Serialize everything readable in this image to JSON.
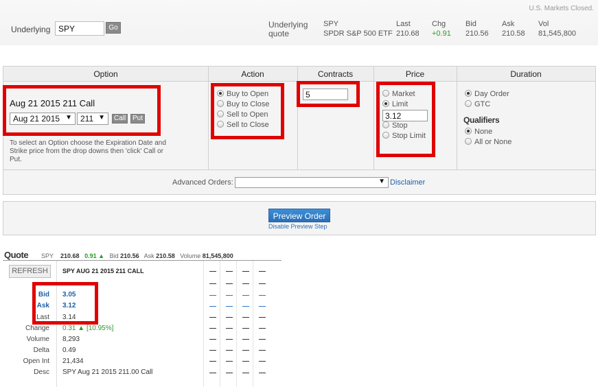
{
  "header": {
    "market_status": "U.S. Markets Closed.",
    "underlying_label": "Underlying",
    "underlying_value": "SPY",
    "go_label": "Go",
    "underlying_quote_label": "Underlying quote",
    "symbol": "SPY",
    "symbol_name": "SPDR S&P 500 ETF",
    "columns": [
      {
        "label": "Last",
        "value": "210.68"
      },
      {
        "label": "Chg",
        "value": "+0.91"
      },
      {
        "label": "Bid",
        "value": "210.56"
      },
      {
        "label": "Ask",
        "value": "210.58"
      },
      {
        "label": "Vol",
        "value": "81,545,800"
      }
    ]
  },
  "order": {
    "headers": {
      "option": "Option",
      "action": "Action",
      "contracts": "Contracts",
      "price": "Price",
      "duration": "Duration"
    },
    "option": {
      "selected": "Aug 21 2015 211 Call",
      "expiration": "Aug 21 2015",
      "strike": "211",
      "call_label": "Call",
      "put_label": "Put",
      "help": "To select an Option choose the Expiration Date and Strike price from the drop downs then 'click' Call or Put."
    },
    "action": [
      {
        "label": "Buy to Open",
        "checked": true
      },
      {
        "label": "Buy to Close",
        "checked": false
      },
      {
        "label": "Sell to Open",
        "checked": false
      },
      {
        "label": "Sell to Close",
        "checked": false
      }
    ],
    "contracts": "5",
    "price": {
      "market": "Market",
      "limit": "Limit",
      "limit_value": "3.12",
      "stop": "Stop",
      "stop_limit": "Stop Limit",
      "selected": "Limit"
    },
    "duration": {
      "day": "Day Order",
      "gtc": "GTC",
      "qualifiers_title": "Qualifiers",
      "none": "None",
      "all_or_none": "All or None"
    },
    "advanced_label": "Advanced Orders:",
    "advanced_value": "",
    "disclaimer": "Disclaimer"
  },
  "preview": {
    "button": "Preview Order",
    "disable": "Disable Preview Step"
  },
  "quote": {
    "title": "Quote",
    "strip": {
      "symbol": "SPY",
      "last": "210.68",
      "change": "0.91",
      "bid_label": "Bid",
      "bid": "210.56",
      "ask_label": "Ask",
      "ask": "210.58",
      "volume_label": "Volume",
      "volume": "81,545,800"
    },
    "refresh": "REFRESH",
    "option_name": "SPY AUG 21 2015 211 CALL",
    "rows": [
      {
        "label": "Bid",
        "value": "3.05"
      },
      {
        "label": "Ask",
        "value": "3.12"
      },
      {
        "label": "Last",
        "value": "3.14"
      },
      {
        "label": "Change",
        "value": "0.31",
        "extra": "[10.95%]"
      },
      {
        "label": "Volume",
        "value": "8,293"
      },
      {
        "label": "Delta",
        "value": "0.49"
      },
      {
        "label": "Open Int",
        "value": "21,434"
      },
      {
        "label": "Desc",
        "value": "SPY Aug 21 2015 211.00 Call"
      }
    ]
  }
}
